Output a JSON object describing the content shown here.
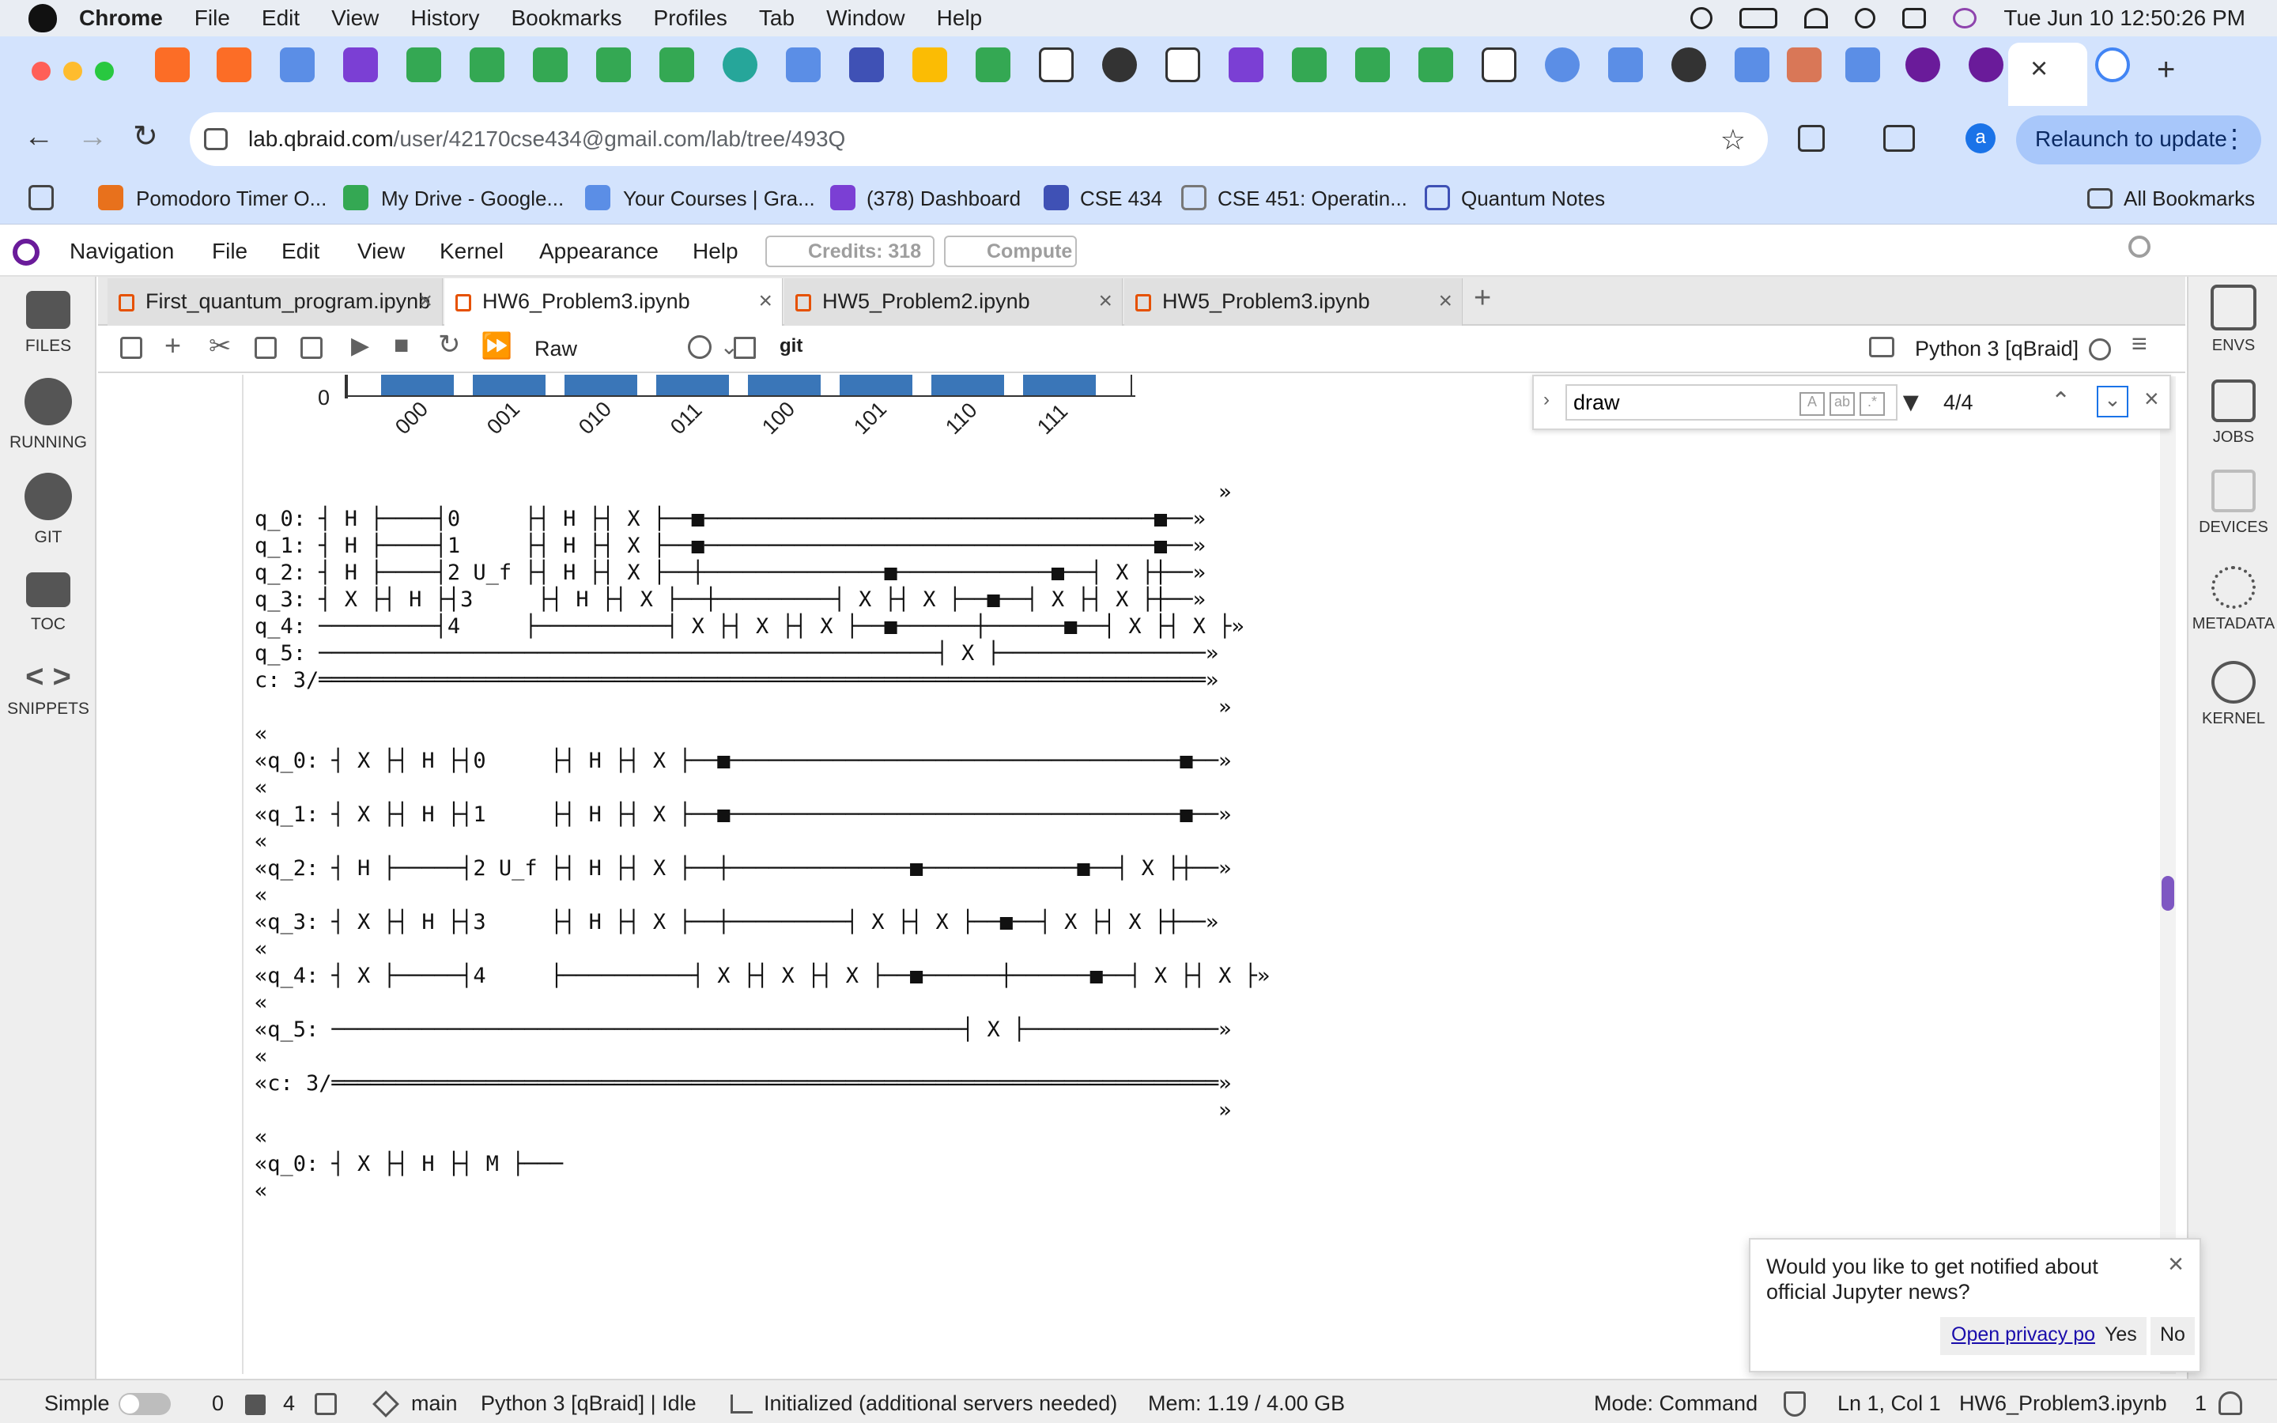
{
  "mac_menubar": {
    "app": "Chrome",
    "items": [
      "File",
      "Edit",
      "View",
      "History",
      "Bookmarks",
      "Profiles",
      "Tab",
      "Window",
      "Help"
    ],
    "datetime": "Tue Jun 10  12:50:26 PM"
  },
  "browser": {
    "url_host": "lab.qbraid.com",
    "url_path": "/user/42170cse434@gmail.com/lab/tree/493Q",
    "relaunch": "Relaunch to update",
    "profile_initial": "a",
    "bookmarks": [
      "Pomodoro Timer O...",
      "My Drive - Google...",
      "Your Courses | Gra...",
      "(378) Dashboard",
      "CSE 434",
      "CSE 451: Operatin...",
      "Quantum Notes"
    ],
    "all_bookmarks": "All Bookmarks"
  },
  "jupyter_menu": {
    "items": [
      "Navigation",
      "File",
      "Edit",
      "View",
      "Kernel",
      "Appearance",
      "Help"
    ],
    "credits": "Credits:  318",
    "compute": "Compute"
  },
  "left_sidebar": [
    "FILES",
    "RUNNING",
    "GIT",
    "TOC",
    "SNIPPETS"
  ],
  "right_sidebar": [
    "ENVS",
    "JOBS",
    "DEVICES",
    "METADATA",
    "KERNEL"
  ],
  "notebook_tabs": [
    {
      "label": "First_quantum_program.ipynb"
    },
    {
      "label": "HW6_Problem3.ipynb"
    },
    {
      "label": "HW5_Problem2.ipynb"
    },
    {
      "label": "HW5_Problem3.ipynb"
    }
  ],
  "notebook_toolbar": {
    "cell_type": "Raw",
    "git": "git",
    "kernel": "Python 3 [qBraid]"
  },
  "findbar": {
    "query": "draw",
    "count": "4/4"
  },
  "histogram": {
    "zero_label": "0",
    "labels": [
      "000",
      "001",
      "010",
      "011",
      "100",
      "101",
      "110",
      "111"
    ]
  },
  "circuit_text": [
    "                                                                           »",
    "q_0: ┤ H ├────┤0     ├┤ H ├┤ X ├──■───────────────────────────────────■──»",
    "q_1: ┤ H ├────┤1     ├┤ H ├┤ X ├──■───────────────────────────────────■──»",
    "q_2: ┤ H ├────┤2 U_f ├┤ H ├┤ X ├──┼──────────────■────────────■──┤ X ├┼──»",
    "q_3: ┤ X ├┤ H ├┤3     ├┤ H ├┤ X ├──┼─────────┤ X ├┤ X ├──■──┤ X ├┤ X ├┼──»",
    "q_4: ─────────┤4     ├──────────┤ X ├┤ X ├┤ X ├──■──────┼──────■──┤ X ├┤ X ├»",
    "q_5: ────────────────────────────────────────────────┤ X ├────────────────»",
    "c: 3/═════════════════════════════════════════════════════════════════════»",
    "                                                                           »",
    "«",
    "«q_0: ┤ X ├┤ H ├┤0     ├┤ H ├┤ X ├──■───────────────────────────────────■──»",
    "«",
    "«q_1: ┤ X ├┤ H ├┤1     ├┤ H ├┤ X ├──■───────────────────────────────────■──»",
    "«",
    "«q_2: ┤ H ├─────┤2 U_f ├┤ H ├┤ X ├──┼──────────────■────────────■──┤ X ├┼──»",
    "«",
    "«q_3: ┤ X ├┤ H ├┤3     ├┤ H ├┤ X ├──┼─────────┤ X ├┤ X ├──■──┤ X ├┤ X ├┼──»",
    "«",
    "«q_4: ┤ X ├─────┤4     ├──────────┤ X ├┤ X ├┤ X ├──■──────┼──────■──┤ X ├┤ X ├»",
    "«",
    "«q_5: ─────────────────────────────────────────────────┤ X ├───────────────»",
    "«",
    "«c: 3/═════════════════════════════════════════════════════════════════════»",
    "                                                                           »",
    "«",
    "«q_0: ┤ X ├┤ H ├┤ M ├───",
    "«"
  ],
  "notification": {
    "text": "Would you like to get notified about official Jupyter news?",
    "privacy": "Open privacy policy",
    "yes": "Yes",
    "no": "No"
  },
  "statusbar": {
    "mode_simple": "Simple",
    "count0": "0",
    "count1": "4",
    "branch": "main",
    "kernel_state": "Python 3 [qBraid] | Idle",
    "init": "Initialized (additional servers needed)",
    "mem": "Mem: 1.19 / 4.00 GB",
    "mode": "Mode: Command",
    "pos": "Ln 1, Col 1",
    "file": "HW6_Problem3.ipynb",
    "notif_count": "1"
  },
  "colors": {
    "chrome_bg": "#d3e3fd",
    "accent_blue": "#3a76b8",
    "qbraid_purple": "#7e57c2"
  }
}
